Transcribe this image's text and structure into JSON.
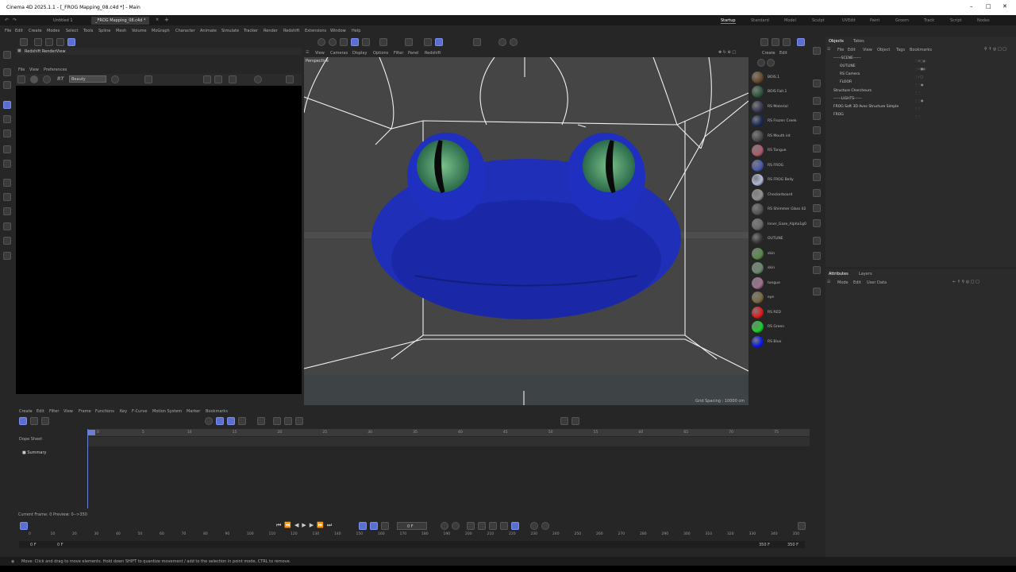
{
  "title": "Cinema 4D 2025.1.1 - [_FROG Mapping_08.c4d *] - Main",
  "doc_tabs": [
    "Untitled 1",
    "_FROG Mapping_08.c4d *"
  ],
  "workspaces": [
    "Startup",
    "Standard",
    "Model",
    "Sculpt",
    "UVEdit",
    "Paint",
    "Groom",
    "Track",
    "Script",
    "Nodes"
  ],
  "menu": [
    "File",
    "Edit",
    "Create",
    "Modes",
    "Select",
    "Tools",
    "Spline",
    "Mesh",
    "Volume",
    "MoGraph",
    "Character",
    "Animate",
    "Simulate",
    "Tracker",
    "Render",
    "Redshift",
    "Extensions",
    "Window",
    "Help"
  ],
  "renderview": {
    "title": "Redshift RenderView",
    "menu": [
      "File",
      "View",
      "Preferences"
    ],
    "rt_label": "RT",
    "aov": "Beauty"
  },
  "viewport": {
    "menu": [
      "View",
      "Cameras",
      "Display",
      "Options",
      "Filter",
      "Panel",
      "Redshift"
    ],
    "label": "Perspective",
    "grid_spacing": "Grid Spacing : 10000 cm"
  },
  "materials_menu": [
    "Create",
    "Edit"
  ],
  "materials": [
    {
      "name": "BOIS.1",
      "color": "#6b4a2a"
    },
    {
      "name": "BOIS Fait.1",
      "color": "#2c5a3e"
    },
    {
      "name": "RS Material",
      "color": "#3a3a55"
    },
    {
      "name": "RS Frozen Creek",
      "color": "#1a2a5a"
    },
    {
      "name": "RS Mouth int",
      "color": "#4a4a4a"
    },
    {
      "name": "RS Tongue",
      "color": "#b05a70"
    },
    {
      "name": "RS FROG",
      "color": "#4a5ab0"
    },
    {
      "name": "RS FROG Belly",
      "color": "#b0b8d8"
    },
    {
      "name": "Checkerboard",
      "color": "#909090"
    },
    {
      "name": "RS Shimmer Glass 02",
      "color": "#555"
    },
    {
      "name": "Inner_Gaze_Alpha1g0",
      "color": "#6a6a6a"
    },
    {
      "name": "OUTLINE",
      "color": "#333"
    },
    {
      "name": "skin",
      "color": "#5a8a4a"
    },
    {
      "name": "skin",
      "color": "#6a8a6a"
    },
    {
      "name": "tongue",
      "color": "#a07090"
    },
    {
      "name": "eye",
      "color": "#7a6a40"
    },
    {
      "name": "RS RED",
      "color": "#e21a1a"
    },
    {
      "name": "RS Green",
      "color": "#1ad02a"
    },
    {
      "name": "RS Blue",
      "color": "#0a1ae8"
    }
  ],
  "objects_tabs": [
    "Objects",
    "Takes"
  ],
  "objects_menu": [
    "File",
    "Edit",
    "View",
    "Object",
    "Tags",
    "Bookmarks"
  ],
  "objects": [
    "------SCENE------",
    "OUTLINE",
    "RS Camera",
    "FLOOR",
    "Structure Chercheurs",
    "------LIGHTS------",
    "FROG Soft 3D Avec Structure Simple",
    "FROG"
  ],
  "attributes_tabs": [
    "Attributes",
    "Layers"
  ],
  "attributes_menu": [
    "Mode",
    "Edit",
    "User Data"
  ],
  "timeline_menu": [
    "Create",
    "Edit",
    "Filter",
    "View",
    "Frame",
    "Functions",
    "Key",
    "F-Curve",
    "Motion System",
    "Marker",
    "Bookmarks"
  ],
  "dope_sheet_label": "Dope Sheet",
  "summary_label": "Summary",
  "timeline_ticks": [
    "0",
    "5",
    "10",
    "15",
    "20",
    "25",
    "30",
    "35",
    "40",
    "45",
    "50",
    "55",
    "60",
    "65",
    "70",
    "75"
  ],
  "current_frame_text": "Current Frame: 0   Preview: 0-->350",
  "frame_field": "0 F",
  "range_ticks": [
    "0",
    "10",
    "20",
    "30",
    "40",
    "50",
    "60",
    "70",
    "80",
    "90",
    "100",
    "110",
    "120",
    "130",
    "140",
    "150",
    "160",
    "170",
    "180",
    "190",
    "200",
    "210",
    "220",
    "230",
    "240",
    "250",
    "260",
    "270",
    "280",
    "290",
    "300",
    "310",
    "320",
    "330",
    "340",
    "350"
  ],
  "range_start": "0 F",
  "range_start2": "0 F",
  "range_end": "350 F",
  "range_end2": "350 F",
  "status_text": "Move: Click and drag to move elements. Hold down SHIFT to quantize movement / add to the selection in point mode, CTRL to remove."
}
